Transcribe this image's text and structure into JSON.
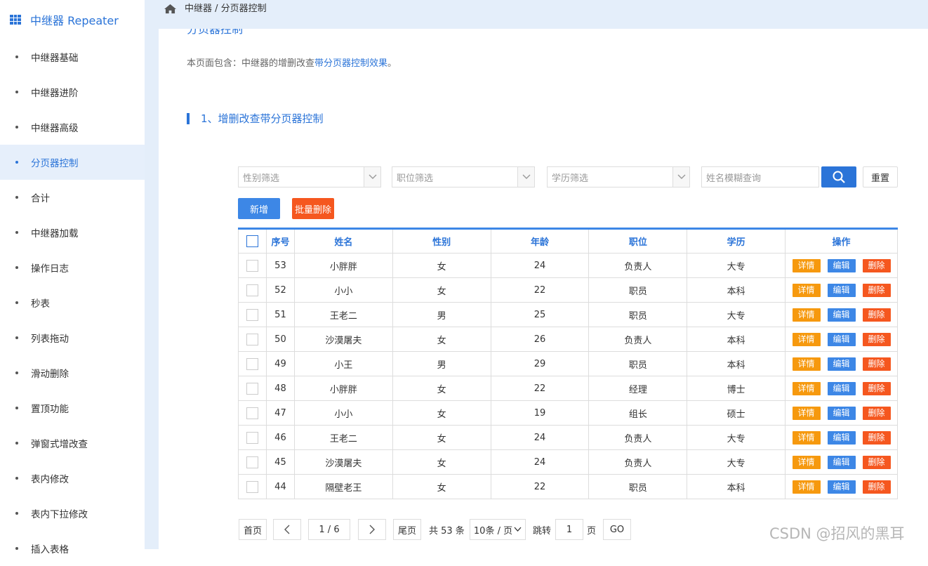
{
  "sidebar": {
    "title": "中继器 Repeater",
    "items": [
      {
        "label": "中继器基础"
      },
      {
        "label": "中继器进阶"
      },
      {
        "label": "中继器高级"
      },
      {
        "label": "分页器控制"
      },
      {
        "label": "合计"
      },
      {
        "label": "中继器加载"
      },
      {
        "label": "操作日志"
      },
      {
        "label": "秒表"
      },
      {
        "label": "列表拖动"
      },
      {
        "label": "滑动删除"
      },
      {
        "label": "置顶功能"
      },
      {
        "label": "弹窗式增改查"
      },
      {
        "label": "表内修改"
      },
      {
        "label": "表内下拉修改"
      },
      {
        "label": "插入表格"
      }
    ],
    "active_index": 3
  },
  "breadcrumb": "中继器 / 分页器控制",
  "page": {
    "heading": "分页器控制",
    "intro_prefix": "本页面包含：中继器的增删改查",
    "intro_link": "带分页器控制效果",
    "intro_suffix": "。",
    "section_title": "1、增删改查带分页器控制"
  },
  "filters": {
    "gender_placeholder": "性别筛选",
    "position_placeholder": "职位筛选",
    "education_placeholder": "学历筛选",
    "name_placeholder": "姓名模糊查询",
    "reset_label": "重置",
    "add_label": "新增",
    "batch_delete_label": "批量删除"
  },
  "table": {
    "headers": [
      "序号",
      "姓名",
      "性别",
      "年龄",
      "职位",
      "学历",
      "操作"
    ],
    "action_labels": {
      "detail": "详情",
      "edit": "编辑",
      "delete": "删除"
    },
    "rows": [
      {
        "id": "53",
        "name": "小胖胖",
        "gender": "女",
        "age": "24",
        "position": "负责人",
        "education": "大专"
      },
      {
        "id": "52",
        "name": "小小",
        "gender": "女",
        "age": "22",
        "position": "职员",
        "education": "本科"
      },
      {
        "id": "51",
        "name": "王老二",
        "gender": "男",
        "age": "25",
        "position": "职员",
        "education": "大专"
      },
      {
        "id": "50",
        "name": "沙漠屠夫",
        "gender": "女",
        "age": "26",
        "position": "负责人",
        "education": "本科"
      },
      {
        "id": "49",
        "name": "小王",
        "gender": "男",
        "age": "29",
        "position": "职员",
        "education": "本科"
      },
      {
        "id": "48",
        "name": "小胖胖",
        "gender": "女",
        "age": "22",
        "position": "经理",
        "education": "博士"
      },
      {
        "id": "47",
        "name": "小小",
        "gender": "女",
        "age": "19",
        "position": "组长",
        "education": "硕士"
      },
      {
        "id": "46",
        "name": "王老二",
        "gender": "女",
        "age": "24",
        "position": "负责人",
        "education": "大专"
      },
      {
        "id": "45",
        "name": "沙漠屠夫",
        "gender": "女",
        "age": "24",
        "position": "负责人",
        "education": "大专"
      },
      {
        "id": "44",
        "name": "隔壁老王",
        "gender": "女",
        "age": "22",
        "position": "职员",
        "education": "本科"
      }
    ]
  },
  "pager": {
    "first": "首页",
    "page_indicator": "1 / 6",
    "last": "尾页",
    "total_text": "共 53 条",
    "per_page": "10条 / 页",
    "jump_label": "跳转",
    "jump_value": "1",
    "page_unit": "页",
    "go": "GO"
  },
  "watermark": "CSDN @招风的黑耳",
  "colors": {
    "accent": "#2b74d8",
    "orange": "#f6990e",
    "red": "#f5571f",
    "blue_btn": "#3d87e6",
    "topbar": "#e4eefa"
  }
}
